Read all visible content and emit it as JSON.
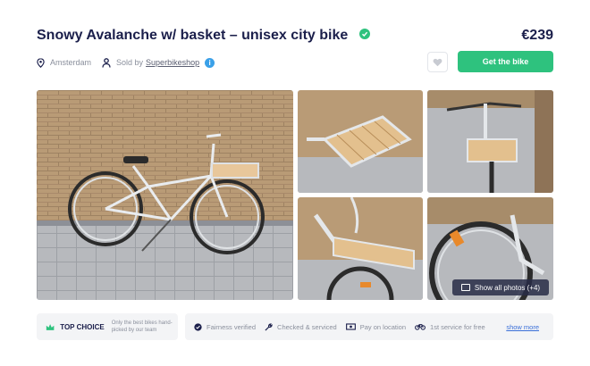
{
  "listing": {
    "title": "Snowy Avalanche w/ basket – unisex city bike",
    "price": "€239",
    "location": "Amsterdam",
    "sold_by_prefix": "Sold by",
    "seller": "Superbikeshop",
    "info_glyph": "i"
  },
  "actions": {
    "buy_label": "Get the bike",
    "show_all_label": "Show all photos (+4)"
  },
  "badges": {
    "top_choice_label": "TOP CHOICE",
    "top_choice_desc": "Only the best bikes hand-picked by our team"
  },
  "features": [
    {
      "label": "Fairness verified",
      "icon": "check-circle-icon"
    },
    {
      "label": "Checked & serviced",
      "icon": "wrench-icon"
    },
    {
      "label": "Pay on location",
      "icon": "cash-icon"
    },
    {
      "label": "1st service for free",
      "icon": "bike-icon"
    }
  ],
  "show_more_label": "show more",
  "colors": {
    "accent": "#2ec27e",
    "title": "#1b1f4b",
    "muted": "#8a8f9c",
    "link": "#3a6fd8",
    "info": "#3aa0e8"
  }
}
